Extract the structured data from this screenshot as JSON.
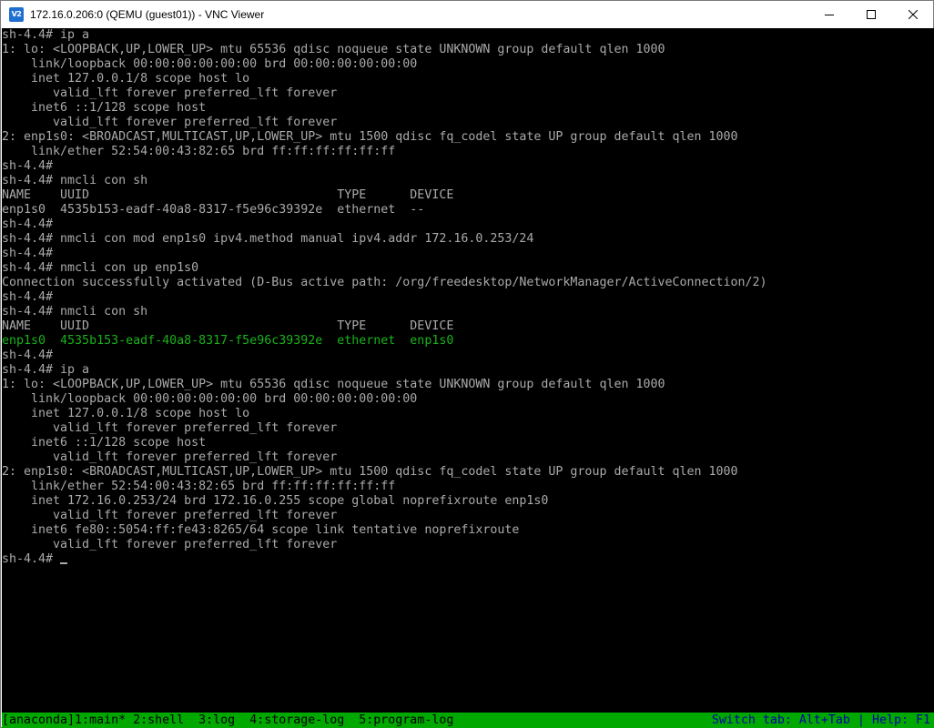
{
  "window": {
    "title": "172.16.0.206:0 (QEMU (guest01)) - VNC Viewer",
    "icon": "vnc-viewer-icon",
    "icon_text": "V2"
  },
  "terminal": {
    "lines": [
      {
        "text": "sh-4.4# ip a",
        "color": "#aaaaaa"
      },
      {
        "text": "1: lo: <LOOPBACK,UP,LOWER_UP> mtu 65536 qdisc noqueue state UNKNOWN group default qlen 1000",
        "color": "#aaaaaa"
      },
      {
        "text": "    link/loopback 00:00:00:00:00:00 brd 00:00:00:00:00:00",
        "color": "#aaaaaa"
      },
      {
        "text": "    inet 127.0.0.1/8 scope host lo",
        "color": "#aaaaaa"
      },
      {
        "text": "       valid_lft forever preferred_lft forever",
        "color": "#aaaaaa"
      },
      {
        "text": "    inet6 ::1/128 scope host",
        "color": "#aaaaaa"
      },
      {
        "text": "       valid_lft forever preferred_lft forever",
        "color": "#aaaaaa"
      },
      {
        "text": "2: enp1s0: <BROADCAST,MULTICAST,UP,LOWER_UP> mtu 1500 qdisc fq_codel state UP group default qlen 1000",
        "color": "#aaaaaa"
      },
      {
        "text": "    link/ether 52:54:00:43:82:65 brd ff:ff:ff:ff:ff:ff",
        "color": "#aaaaaa"
      },
      {
        "text": "sh-4.4#",
        "color": "#aaaaaa"
      },
      {
        "text": "sh-4.4# nmcli con sh",
        "color": "#aaaaaa"
      },
      {
        "text": "NAME    UUID                                  TYPE      DEVICE",
        "color": "#aaaaaa"
      },
      {
        "text": "enp1s0  4535b153-eadf-40a8-8317-f5e96c39392e  ethernet  --",
        "color": "#aaaaaa"
      },
      {
        "text": "sh-4.4#",
        "color": "#aaaaaa"
      },
      {
        "text": "sh-4.4# nmcli con mod enp1s0 ipv4.method manual ipv4.addr 172.16.0.253/24",
        "color": "#aaaaaa"
      },
      {
        "text": "sh-4.4#",
        "color": "#aaaaaa"
      },
      {
        "text": "sh-4.4# nmcli con up enp1s0",
        "color": "#aaaaaa"
      },
      {
        "text": "Connection successfully activated (D-Bus active path: /org/freedesktop/NetworkManager/ActiveConnection/2)",
        "color": "#aaaaaa"
      },
      {
        "text": "sh-4.4#",
        "color": "#aaaaaa"
      },
      {
        "text": "sh-4.4# nmcli con sh",
        "color": "#aaaaaa"
      },
      {
        "text": "NAME    UUID                                  TYPE      DEVICE",
        "color": "#aaaaaa"
      },
      {
        "text": "enp1s0  4535b153-eadf-40a8-8317-f5e96c39392e  ethernet  enp1s0",
        "color": "#1ab21a"
      },
      {
        "text": "sh-4.4#",
        "color": "#aaaaaa"
      },
      {
        "text": "sh-4.4# ip a",
        "color": "#aaaaaa"
      },
      {
        "text": "1: lo: <LOOPBACK,UP,LOWER_UP> mtu 65536 qdisc noqueue state UNKNOWN group default qlen 1000",
        "color": "#aaaaaa"
      },
      {
        "text": "    link/loopback 00:00:00:00:00:00 brd 00:00:00:00:00:00",
        "color": "#aaaaaa"
      },
      {
        "text": "    inet 127.0.0.1/8 scope host lo",
        "color": "#aaaaaa"
      },
      {
        "text": "       valid_lft forever preferred_lft forever",
        "color": "#aaaaaa"
      },
      {
        "text": "    inet6 ::1/128 scope host",
        "color": "#aaaaaa"
      },
      {
        "text": "       valid_lft forever preferred_lft forever",
        "color": "#aaaaaa"
      },
      {
        "text": "2: enp1s0: <BROADCAST,MULTICAST,UP,LOWER_UP> mtu 1500 qdisc fq_codel state UP group default qlen 1000",
        "color": "#aaaaaa"
      },
      {
        "text": "    link/ether 52:54:00:43:82:65 brd ff:ff:ff:ff:ff:ff",
        "color": "#aaaaaa"
      },
      {
        "text": "    inet 172.16.0.253/24 brd 172.16.0.255 scope global noprefixroute enp1s0",
        "color": "#aaaaaa"
      },
      {
        "text": "       valid_lft forever preferred_lft forever",
        "color": "#aaaaaa"
      },
      {
        "text": "    inet6 fe80::5054:ff:fe43:8265/64 scope link tentative noprefixroute",
        "color": "#aaaaaa"
      },
      {
        "text": "       valid_lft forever preferred_lft forever",
        "color": "#aaaaaa"
      },
      {
        "text": "sh-4.4# ",
        "color": "#aaaaaa",
        "cursor": true
      }
    ]
  },
  "statusbar": {
    "left": "[anaconda]1:main* 2:shell  3:log  4:storage-log  5:program-log",
    "right": "Switch tab: Alt+Tab | Help: F1",
    "background": "#00a800",
    "left_color": "#000000",
    "right_color": "#0000aa"
  }
}
